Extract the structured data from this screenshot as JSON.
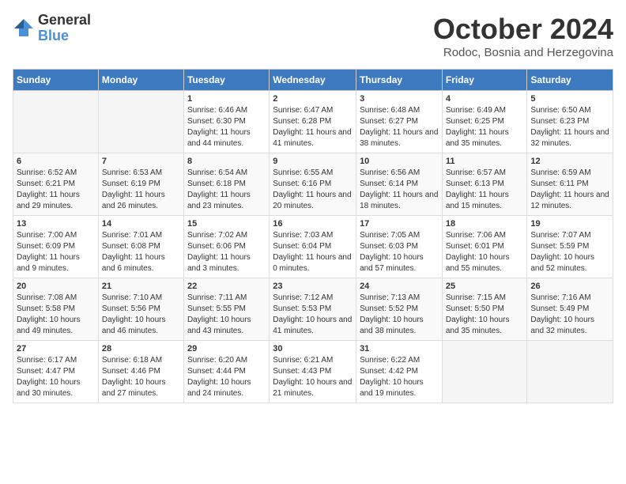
{
  "logo": {
    "general": "General",
    "blue": "Blue"
  },
  "header": {
    "month": "October 2024",
    "location": "Rodoc, Bosnia and Herzegovina"
  },
  "weekdays": [
    "Sunday",
    "Monday",
    "Tuesday",
    "Wednesday",
    "Thursday",
    "Friday",
    "Saturday"
  ],
  "weeks": [
    [
      {
        "day": "",
        "sunrise": "",
        "sunset": "",
        "daylight": ""
      },
      {
        "day": "",
        "sunrise": "",
        "sunset": "",
        "daylight": ""
      },
      {
        "day": "1",
        "sunrise": "Sunrise: 6:46 AM",
        "sunset": "Sunset: 6:30 PM",
        "daylight": "Daylight: 11 hours and 44 minutes."
      },
      {
        "day": "2",
        "sunrise": "Sunrise: 6:47 AM",
        "sunset": "Sunset: 6:28 PM",
        "daylight": "Daylight: 11 hours and 41 minutes."
      },
      {
        "day": "3",
        "sunrise": "Sunrise: 6:48 AM",
        "sunset": "Sunset: 6:27 PM",
        "daylight": "Daylight: 11 hours and 38 minutes."
      },
      {
        "day": "4",
        "sunrise": "Sunrise: 6:49 AM",
        "sunset": "Sunset: 6:25 PM",
        "daylight": "Daylight: 11 hours and 35 minutes."
      },
      {
        "day": "5",
        "sunrise": "Sunrise: 6:50 AM",
        "sunset": "Sunset: 6:23 PM",
        "daylight": "Daylight: 11 hours and 32 minutes."
      }
    ],
    [
      {
        "day": "6",
        "sunrise": "Sunrise: 6:52 AM",
        "sunset": "Sunset: 6:21 PM",
        "daylight": "Daylight: 11 hours and 29 minutes."
      },
      {
        "day": "7",
        "sunrise": "Sunrise: 6:53 AM",
        "sunset": "Sunset: 6:19 PM",
        "daylight": "Daylight: 11 hours and 26 minutes."
      },
      {
        "day": "8",
        "sunrise": "Sunrise: 6:54 AM",
        "sunset": "Sunset: 6:18 PM",
        "daylight": "Daylight: 11 hours and 23 minutes."
      },
      {
        "day": "9",
        "sunrise": "Sunrise: 6:55 AM",
        "sunset": "Sunset: 6:16 PM",
        "daylight": "Daylight: 11 hours and 20 minutes."
      },
      {
        "day": "10",
        "sunrise": "Sunrise: 6:56 AM",
        "sunset": "Sunset: 6:14 PM",
        "daylight": "Daylight: 11 hours and 18 minutes."
      },
      {
        "day": "11",
        "sunrise": "Sunrise: 6:57 AM",
        "sunset": "Sunset: 6:13 PM",
        "daylight": "Daylight: 11 hours and 15 minutes."
      },
      {
        "day": "12",
        "sunrise": "Sunrise: 6:59 AM",
        "sunset": "Sunset: 6:11 PM",
        "daylight": "Daylight: 11 hours and 12 minutes."
      }
    ],
    [
      {
        "day": "13",
        "sunrise": "Sunrise: 7:00 AM",
        "sunset": "Sunset: 6:09 PM",
        "daylight": "Daylight: 11 hours and 9 minutes."
      },
      {
        "day": "14",
        "sunrise": "Sunrise: 7:01 AM",
        "sunset": "Sunset: 6:08 PM",
        "daylight": "Daylight: 11 hours and 6 minutes."
      },
      {
        "day": "15",
        "sunrise": "Sunrise: 7:02 AM",
        "sunset": "Sunset: 6:06 PM",
        "daylight": "Daylight: 11 hours and 3 minutes."
      },
      {
        "day": "16",
        "sunrise": "Sunrise: 7:03 AM",
        "sunset": "Sunset: 6:04 PM",
        "daylight": "Daylight: 11 hours and 0 minutes."
      },
      {
        "day": "17",
        "sunrise": "Sunrise: 7:05 AM",
        "sunset": "Sunset: 6:03 PM",
        "daylight": "Daylight: 10 hours and 57 minutes."
      },
      {
        "day": "18",
        "sunrise": "Sunrise: 7:06 AM",
        "sunset": "Sunset: 6:01 PM",
        "daylight": "Daylight: 10 hours and 55 minutes."
      },
      {
        "day": "19",
        "sunrise": "Sunrise: 7:07 AM",
        "sunset": "Sunset: 5:59 PM",
        "daylight": "Daylight: 10 hours and 52 minutes."
      }
    ],
    [
      {
        "day": "20",
        "sunrise": "Sunrise: 7:08 AM",
        "sunset": "Sunset: 5:58 PM",
        "daylight": "Daylight: 10 hours and 49 minutes."
      },
      {
        "day": "21",
        "sunrise": "Sunrise: 7:10 AM",
        "sunset": "Sunset: 5:56 PM",
        "daylight": "Daylight: 10 hours and 46 minutes."
      },
      {
        "day": "22",
        "sunrise": "Sunrise: 7:11 AM",
        "sunset": "Sunset: 5:55 PM",
        "daylight": "Daylight: 10 hours and 43 minutes."
      },
      {
        "day": "23",
        "sunrise": "Sunrise: 7:12 AM",
        "sunset": "Sunset: 5:53 PM",
        "daylight": "Daylight: 10 hours and 41 minutes."
      },
      {
        "day": "24",
        "sunrise": "Sunrise: 7:13 AM",
        "sunset": "Sunset: 5:52 PM",
        "daylight": "Daylight: 10 hours and 38 minutes."
      },
      {
        "day": "25",
        "sunrise": "Sunrise: 7:15 AM",
        "sunset": "Sunset: 5:50 PM",
        "daylight": "Daylight: 10 hours and 35 minutes."
      },
      {
        "day": "26",
        "sunrise": "Sunrise: 7:16 AM",
        "sunset": "Sunset: 5:49 PM",
        "daylight": "Daylight: 10 hours and 32 minutes."
      }
    ],
    [
      {
        "day": "27",
        "sunrise": "Sunrise: 6:17 AM",
        "sunset": "Sunset: 4:47 PM",
        "daylight": "Daylight: 10 hours and 30 minutes."
      },
      {
        "day": "28",
        "sunrise": "Sunrise: 6:18 AM",
        "sunset": "Sunset: 4:46 PM",
        "daylight": "Daylight: 10 hours and 27 minutes."
      },
      {
        "day": "29",
        "sunrise": "Sunrise: 6:20 AM",
        "sunset": "Sunset: 4:44 PM",
        "daylight": "Daylight: 10 hours and 24 minutes."
      },
      {
        "day": "30",
        "sunrise": "Sunrise: 6:21 AM",
        "sunset": "Sunset: 4:43 PM",
        "daylight": "Daylight: 10 hours and 21 minutes."
      },
      {
        "day": "31",
        "sunrise": "Sunrise: 6:22 AM",
        "sunset": "Sunset: 4:42 PM",
        "daylight": "Daylight: 10 hours and 19 minutes."
      },
      {
        "day": "",
        "sunrise": "",
        "sunset": "",
        "daylight": ""
      },
      {
        "day": "",
        "sunrise": "",
        "sunset": "",
        "daylight": ""
      }
    ]
  ]
}
